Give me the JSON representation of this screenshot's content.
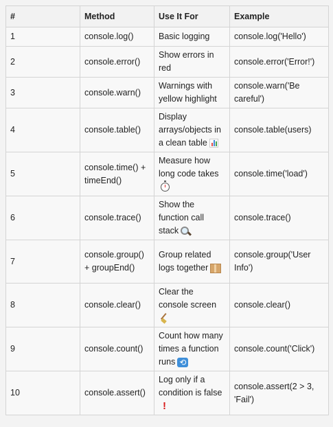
{
  "columns": [
    "#",
    "Method",
    "Use It For",
    "Example"
  ],
  "rows": [
    {
      "num": "1",
      "method": "console.log()",
      "use": "Basic logging",
      "example": "console.log('Hello')",
      "icon": ""
    },
    {
      "num": "2",
      "method": "console.error()",
      "use": "Show errors in red",
      "example": "console.error('Error!')",
      "icon": ""
    },
    {
      "num": "3",
      "method": "console.warn()",
      "use": "Warnings with yellow highlight",
      "example": "console.warn('Be careful')",
      "icon": ""
    },
    {
      "num": "4",
      "method": "console.table()",
      "use": "Display arrays/objects in a clean table",
      "example": "console.table(users)",
      "icon": "bar-chart-icon"
    },
    {
      "num": "5",
      "method": "console.time() + timeEnd()",
      "use": "Measure how long code takes",
      "example": "console.time('load')",
      "icon": "stopwatch-icon"
    },
    {
      "num": "6",
      "method": "console.trace()",
      "use": "Show the function call stack",
      "example": "console.trace()",
      "icon": "magnifier-icon"
    },
    {
      "num": "7",
      "method": "console.group() + groupEnd()",
      "use": "Group related logs together",
      "example": "console.group('User Info')",
      "icon": "package-icon"
    },
    {
      "num": "8",
      "method": "console.clear()",
      "use": "Clear the console screen",
      "example": "console.clear()",
      "icon": "broom-icon"
    },
    {
      "num": "9",
      "method": "console.count()",
      "use": "Count how many times a function runs",
      "example": "console.count('Click')",
      "icon": "repeat-icon"
    },
    {
      "num": "10",
      "method": "console.assert()",
      "use": "Log only if a condition is false",
      "example": "console.assert(2 > 3, 'Fail')",
      "icon": "exclamation-icon"
    }
  ]
}
